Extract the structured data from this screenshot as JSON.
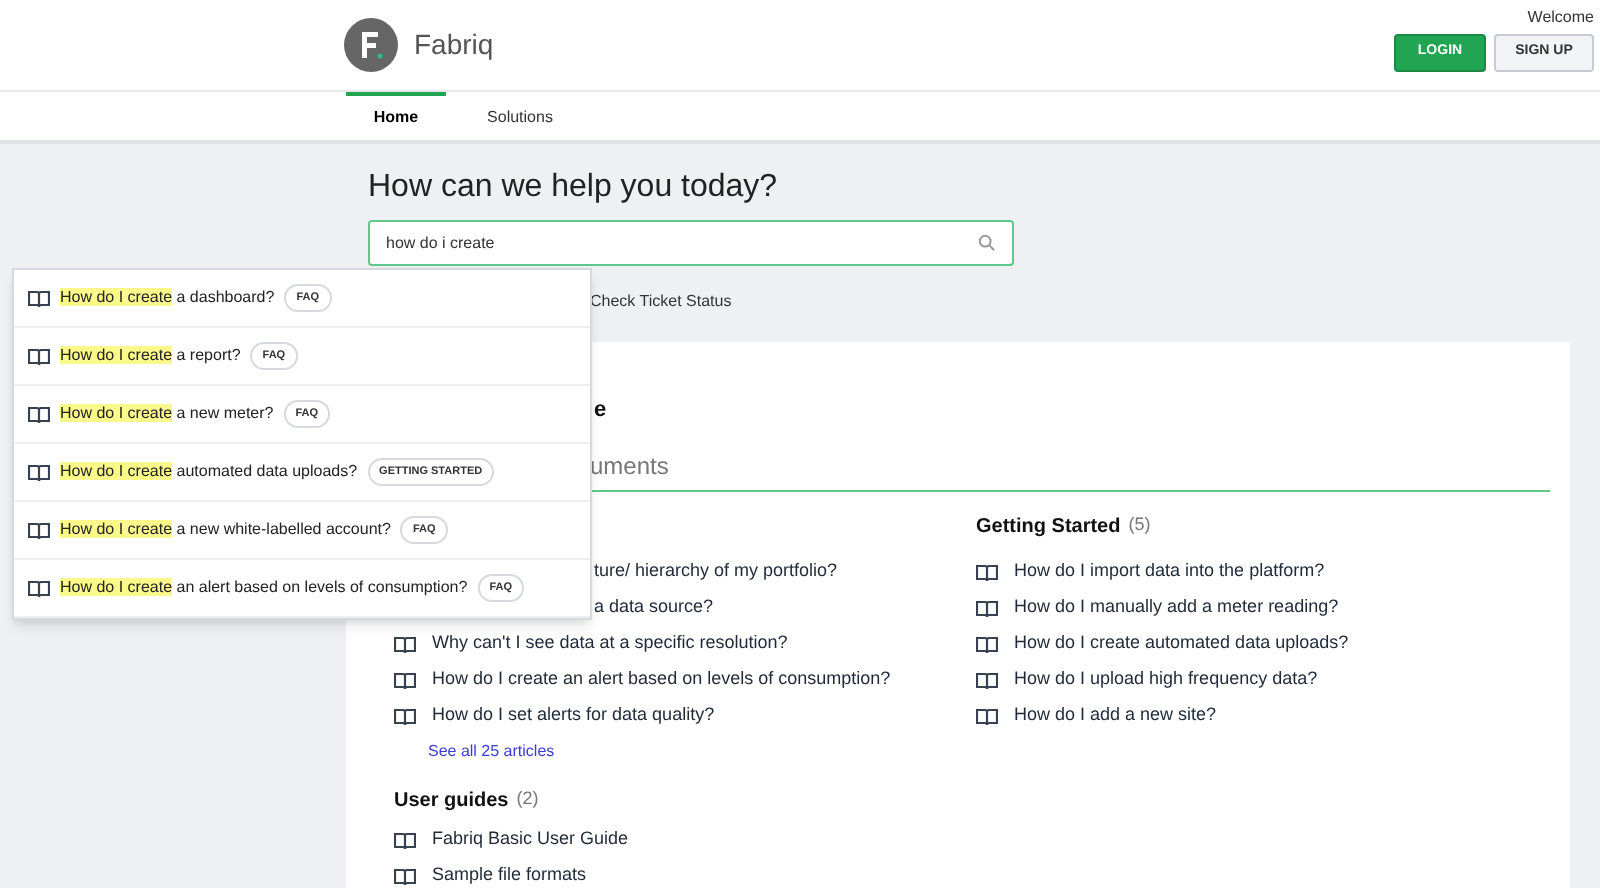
{
  "header": {
    "brand": "Fabriq",
    "welcome": "Welcome",
    "buttons": [
      {
        "label": "LOGIN",
        "kind": "primary"
      },
      {
        "label": "SIGN UP",
        "kind": "secondary"
      }
    ]
  },
  "nav": [
    {
      "label": "Home",
      "selected": true
    },
    {
      "label": "Solutions",
      "selected": false
    }
  ],
  "hero": {
    "title": "How can we help you today?",
    "search": {
      "value": "how do i create"
    },
    "link": "Check Ticket Status"
  },
  "suggestions": [
    {
      "match": "How do I create",
      "rest": " a dashboard?",
      "tag": "FAQ"
    },
    {
      "match": "How do I create",
      "rest": " a report?",
      "tag": "FAQ"
    },
    {
      "match": "How do I create",
      "rest": " a new meter?",
      "tag": "FAQ"
    },
    {
      "match": "How do I create",
      "rest": " automated data uploads?",
      "tag": "GETTING STARTED"
    },
    {
      "match": "How do I create",
      "rest": " a new white-labelled account?",
      "tag": "FAQ"
    },
    {
      "match": "How do I create",
      "rest": " an alert based on levels of consumption?",
      "tag": "FAQ"
    }
  ],
  "card": {
    "heading_fragment": "e",
    "tab_fragment": "uments",
    "left_items": [
      {
        "text": "ture/ hierarchy of my portfolio?",
        "kind": "cut"
      },
      {
        "text": "a data source?",
        "kind": "cut"
      },
      {
        "text": "Why can't I see data at a specific resolution?",
        "kind": "article"
      },
      {
        "text": "How do I create an alert based on levels of consumption?",
        "kind": "article"
      },
      {
        "text": "How do I set alerts for data quality?",
        "kind": "article"
      }
    ],
    "see_all": "See all 25 articles",
    "right_section": {
      "title": "Getting Started",
      "count": "(5)",
      "items": [
        "How do I import data into the platform?",
        "How do I manually add a meter reading?",
        "How do I create automated data uploads?",
        "How do I upload high frequency data?",
        "How do I add a new site?"
      ]
    },
    "user_guides": {
      "title": "User guides",
      "count": "(2)",
      "items": [
        "Fabriq Basic User Guide",
        "Sample file formats"
      ]
    }
  }
}
